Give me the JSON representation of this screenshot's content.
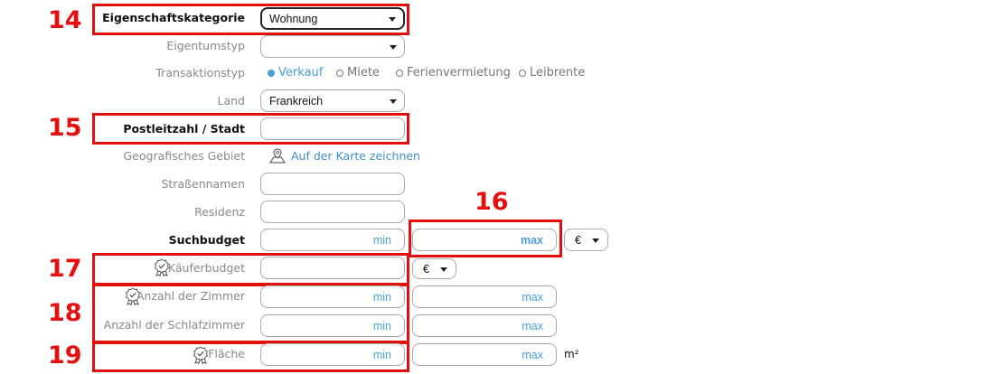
{
  "annotations": {
    "n14": "14",
    "n15": "15",
    "n16": "16",
    "n17": "17",
    "n18": "18",
    "n19": "19"
  },
  "labels": {
    "property_category": "Eigenschaftskategorie",
    "ownership_type": "Eigentumstyp",
    "transaction_type": "Transaktionstyp",
    "country": "Land",
    "postal_city": "Postleitzahl / Stadt",
    "geo_area": "Geografisches Gebiet",
    "street_names": "Straßennamen",
    "residence": "Residenz",
    "search_budget": "Suchbudget",
    "buyer_budget": "Käuferbudget",
    "num_rooms": "Anzahl der Zimmer",
    "num_bedrooms": "Anzahl der Schlafzimmer",
    "area": "Fläche"
  },
  "values": {
    "property_category": "Wohnung",
    "ownership_type": "",
    "country": "Frankreich",
    "search_budget_currency": "€",
    "buyer_budget_currency": "€"
  },
  "transaction_options": [
    {
      "label": "Verkauf",
      "selected": true
    },
    {
      "label": "Miete",
      "selected": false
    },
    {
      "label": "Ferienvermietung",
      "selected": false
    },
    {
      "label": "Leibrente",
      "selected": false
    }
  ],
  "geo_link": "Auf der Karte zeichnen",
  "placeholders": {
    "min": "min",
    "max": "max"
  },
  "area_unit": "m²",
  "colors": {
    "annotation_red": "#e20f0f",
    "accent_blue": "#4a9fd8"
  }
}
